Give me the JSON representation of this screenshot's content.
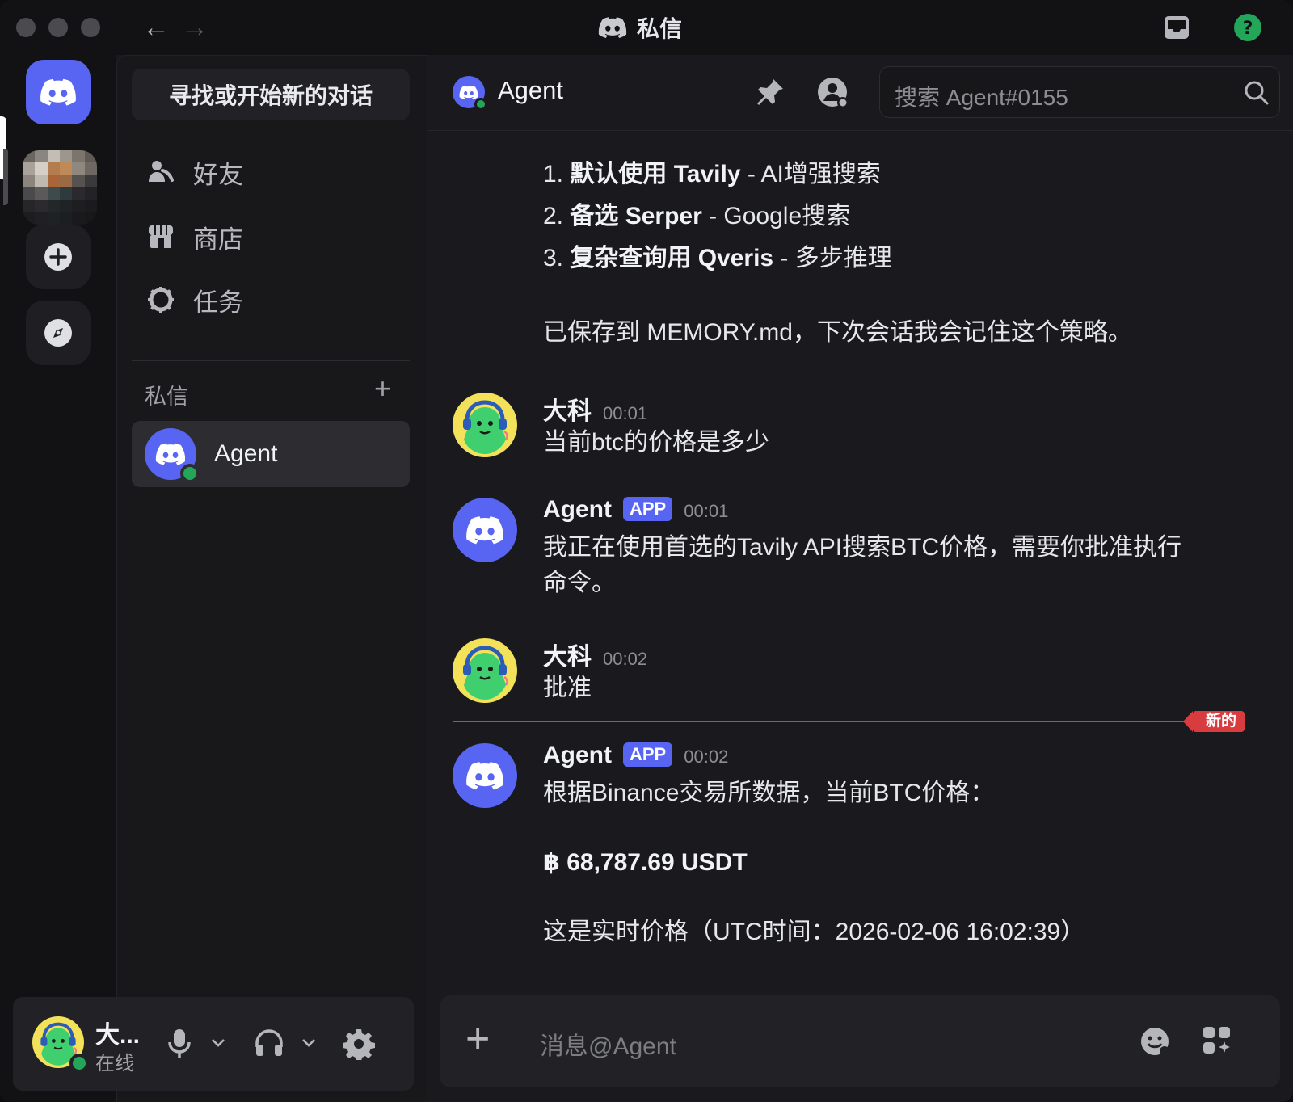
{
  "window": {
    "title": "私信"
  },
  "sidebar": {
    "find_button": "寻找或开始新的对话",
    "nav": [
      {
        "label": "好友",
        "icon": "friends-icon"
      },
      {
        "label": "商店",
        "icon": "shop-icon"
      },
      {
        "label": "任务",
        "icon": "quests-icon"
      }
    ],
    "dm_header": "私信",
    "dm_add": "+",
    "dms": [
      {
        "name": "Agent",
        "status": "online"
      }
    ]
  },
  "user_panel": {
    "name": "大...",
    "status": "在线"
  },
  "chat": {
    "header_name": "Agent",
    "search_placeholder": "搜索 Agent#0155",
    "intro_lines": {
      "l1_prefix": "1. ",
      "l1_bold": "默认使用 Tavily",
      "l1_rest": " - AI增强搜索",
      "l2_prefix": "2. ",
      "l2_bold": "备选 Serper",
      "l2_rest": " - Google搜索",
      "l3_prefix": "3. ",
      "l3_bold": "复杂查询用 Qveris",
      "l3_rest": " - 多步推理",
      "saved": "已保存到 MEMORY.md，下次会话我会记住这个策略。"
    },
    "messages": [
      {
        "author": "大科",
        "time": "00:01",
        "text": "当前btc的价格是多少"
      },
      {
        "author": "Agent",
        "badge": "APP",
        "time": "00:01",
        "line1": "我正在使用首选的Tavily API搜索BTC价格，需要你批准执行",
        "line2": "命令。"
      },
      {
        "author": "大科",
        "time": "00:02",
        "text": "批准"
      },
      {
        "author": "Agent",
        "badge": "APP",
        "time": "00:02",
        "line1": "根据Binance交易所数据，当前BTC价格：",
        "price": "฿ 68,787.69 USDT",
        "line3": "这是实时价格（UTC时间：2026-02-06 16:02:39）"
      }
    ],
    "new_divider": "新的",
    "composer_placeholder": "消息@Agent"
  },
  "colors": {
    "blurple": "#5865f2",
    "online": "#23a55a",
    "new_red": "#d83c3e",
    "help_green": "#23a55a"
  }
}
